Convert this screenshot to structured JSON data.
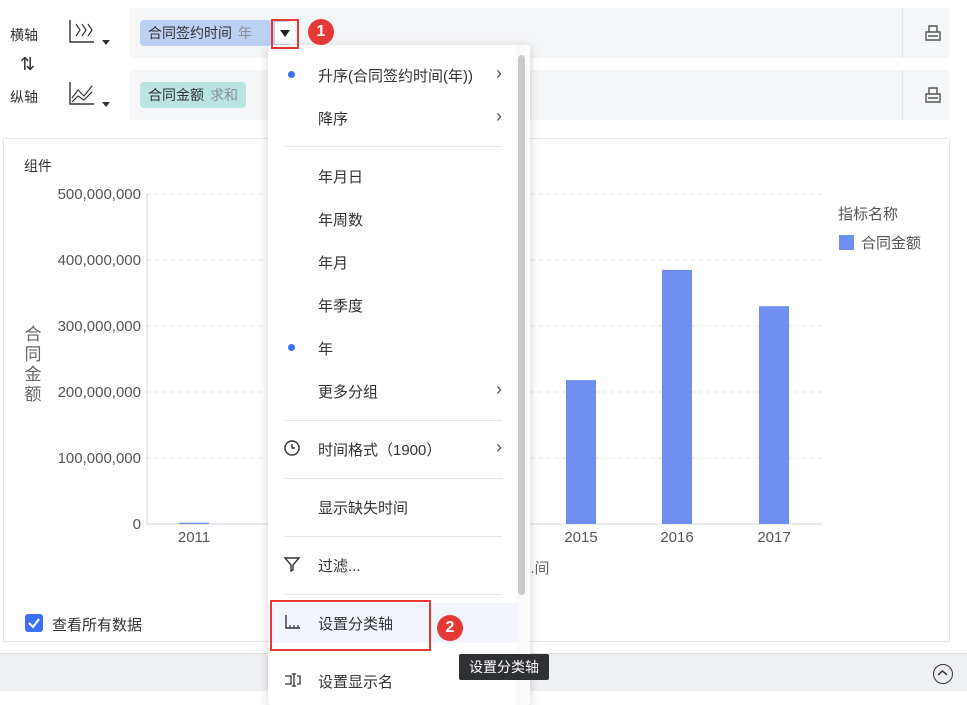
{
  "rows": {
    "x": {
      "label": "横轴",
      "pill_main": "合同签约时间",
      "pill_sub": "年"
    },
    "y": {
      "label": "纵轴",
      "pill_main": "合同金额",
      "pill_sub": "求和"
    }
  },
  "swap_icon": "swap-vertical-icon",
  "component_label": "组件",
  "chart_data": {
    "type": "bar",
    "categories": [
      "2011",
      "2015",
      "2016",
      "2017"
    ],
    "values": [
      2000000,
      218000000,
      385000000,
      330000000
    ],
    "ylabel": "合同金额",
    "xlabel": "...间",
    "ylim": [
      0,
      500000000
    ],
    "yticks": [
      "0",
      "100,000,000",
      "200,000,000",
      "300,000,000",
      "400,000,000",
      "500,000,000"
    ],
    "legend": {
      "title": "指标名称",
      "series": "合同金额",
      "position": "top-right"
    },
    "bar_color": "#6e8ff0",
    "grid": true
  },
  "show_all_label": "查看所有数据",
  "menu": {
    "items": [
      {
        "label": "升序(合同签约时间(年))",
        "dot": true,
        "chevron": true
      },
      {
        "label": "降序",
        "dot": false,
        "chevron": true
      },
      {
        "label": "年月日",
        "dot": false,
        "chevron": false
      },
      {
        "label": "年周数",
        "dot": false,
        "chevron": false
      },
      {
        "label": "年月",
        "dot": false,
        "chevron": false
      },
      {
        "label": "年季度",
        "dot": false,
        "chevron": false
      },
      {
        "label": "年",
        "dot": true,
        "chevron": false
      },
      {
        "label": "更多分组",
        "dot": false,
        "chevron": true
      },
      {
        "label": "时间格式（1900）",
        "icon": "clock-icon",
        "chevron": true
      },
      {
        "label": "显示缺失时间",
        "dot": false,
        "chevron": false
      },
      {
        "label": "过滤...",
        "icon": "filter-icon",
        "chevron": false
      },
      {
        "label": "设置分类轴",
        "icon": "category-axis-icon",
        "chevron": false
      },
      {
        "label": "设置显示名",
        "icon": "rename-icon",
        "chevron": false
      }
    ]
  },
  "annotations": {
    "step1": "1",
    "step2": "2"
  },
  "tooltip": "设置分类轴",
  "accent_color": "#3b6ff5",
  "highlight_color": "#e53935"
}
